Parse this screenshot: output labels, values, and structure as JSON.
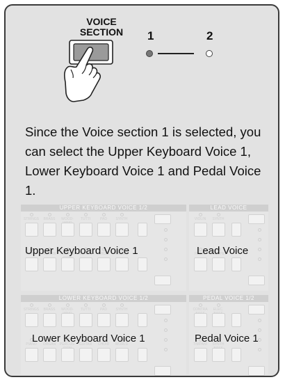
{
  "header": {
    "voice_section_label": "VOICE\nSECTION",
    "section_1": "1",
    "section_2": "2"
  },
  "description": "Since the Voice section 1 is selected, you can select the Upper Keyboard Voice 1, Lower Keyboard Voice 1 and Pedal Voice 1.",
  "panels": {
    "upper": {
      "header": "UPPER KEYBOARD VOICE 1/2",
      "overlay": "Upper Keyboard Voice 1",
      "top_labels": [
        "STRINGS",
        "BRASS",
        "WOOD-WIND",
        "TUTTI",
        "PAD",
        "SYNTH"
      ],
      "bottom_labels": [
        "PIANO",
        "ORGAN",
        "PERCUS-SION",
        "GUITAR",
        "CHOIR",
        "WORLD"
      ]
    },
    "lead": {
      "header": "LEAD VOICE",
      "overlay": "Lead Voice",
      "top_labels": [
        "VIOLIN",
        "SYNTH"
      ],
      "bottom_labels": [
        "FLUTE",
        "TRUMPET"
      ]
    },
    "lower": {
      "header": "LOWER KEYBOARD VOICE 1/2",
      "overlay": "Lower Keyboard Voice 1",
      "top_labels": [
        "STRINGS",
        "BRASS",
        "WOOD-WIND",
        "TUTTI",
        "PAD",
        "SYNTH"
      ],
      "bottom_labels": [
        "PIANO",
        "ORGAN",
        "PERCUS-SION",
        "GUITAR",
        "CHOIR",
        "WORLD"
      ]
    },
    "pedal": {
      "header": "PEDAL VOICE 1/2",
      "overlay": "Pedal Voice 1",
      "top_labels": [
        "CONTRA BASS",
        "ELEC. BASS"
      ],
      "bottom_labels": [
        "TIMPANI",
        "SYNTH BASS"
      ]
    }
  },
  "colors": {
    "frame_bg": "#e2e2e2",
    "selected_indicator": "#777777",
    "panel_outline": "#d0d0d0"
  }
}
